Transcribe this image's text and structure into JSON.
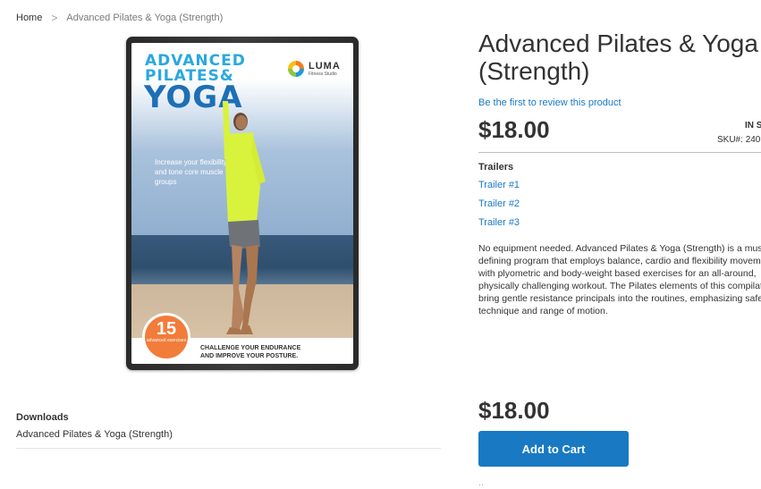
{
  "breadcrumb": {
    "home": "Home",
    "separator": ">",
    "current": "Advanced Pilates & Yoga (Strength)"
  },
  "product": {
    "title_line1": "Advanced Pilates & Yoga",
    "title_line2": "(Strength)",
    "review_link": "Be the first to review this product",
    "price": "$18.00",
    "stock": "IN S",
    "sku_label": "SKU#:",
    "sku_value": "240",
    "trailers_title": "Trailers",
    "trailers": [
      "Trailer #1",
      "Trailer #2",
      "Trailer #3"
    ],
    "description_lines": [
      "No equipment needed. Advanced Pilates & Yoga (Strength) is a musc",
      "defining program that employs balance, cardio and flexibility movem",
      "with plyometric and body-weight based exercises for an all-around,",
      "physically challenging workout. The Pilates elements of this compilat",
      "bring gentle resistance principals into the routines, emphasizing safe",
      "technique and range of motion."
    ],
    "price_bottom": "$18.00",
    "add_to_cart": "Add to Cart",
    "below_button": "··"
  },
  "downloads": {
    "title": "Downloads",
    "item": "Advanced Pilates & Yoga (Strength)"
  },
  "cover": {
    "line1": "ADVANCED",
    "line2": "PILATES&",
    "line3": "YOGA",
    "brand": "LUMA",
    "brand_sub": "Fitness Studio",
    "tagline": "Increase your flexibility and tone core muscle groups",
    "badge_number": "15",
    "badge_text": "advanced exercises",
    "challenge_line1": "CHALLENGE YOUR ENDURANCE",
    "challenge_line2": "AND IMPROVE YOUR POSTURE."
  },
  "colors": {
    "link": "#1979c3",
    "button": "#1979c3",
    "text": "#333333"
  }
}
